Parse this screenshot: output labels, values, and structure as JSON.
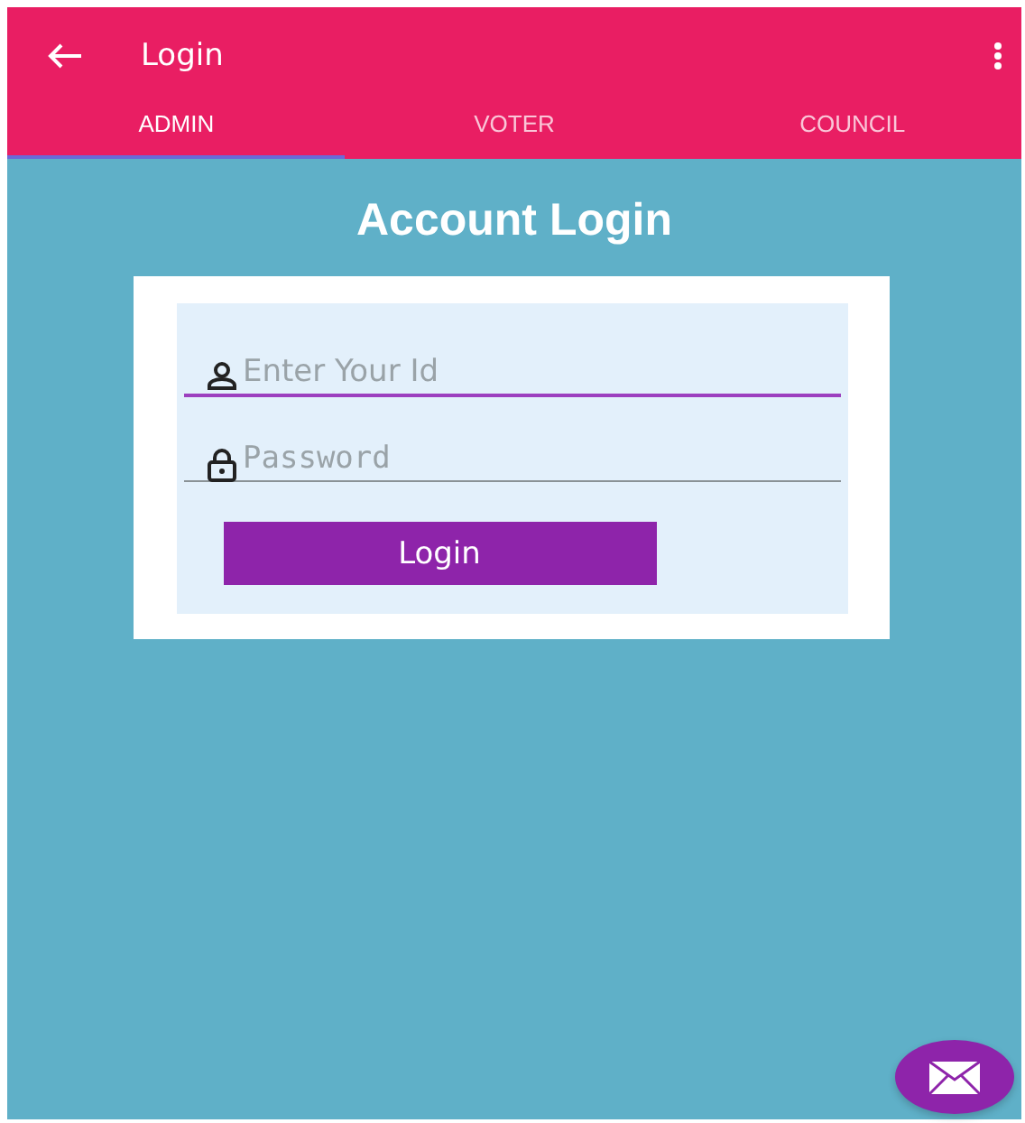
{
  "app_bar": {
    "title": "Login"
  },
  "tabs": [
    {
      "label": "ADMIN",
      "selected": true
    },
    {
      "label": "VOTER",
      "selected": false
    },
    {
      "label": "COUNCIL",
      "selected": false
    }
  ],
  "heading": "Account Login",
  "fields": [
    {
      "kind": "user",
      "placeholder": "Enter Your Id",
      "focused": true
    },
    {
      "kind": "password",
      "placeholder": "Password",
      "focused": false
    }
  ],
  "login_button": "Login"
}
